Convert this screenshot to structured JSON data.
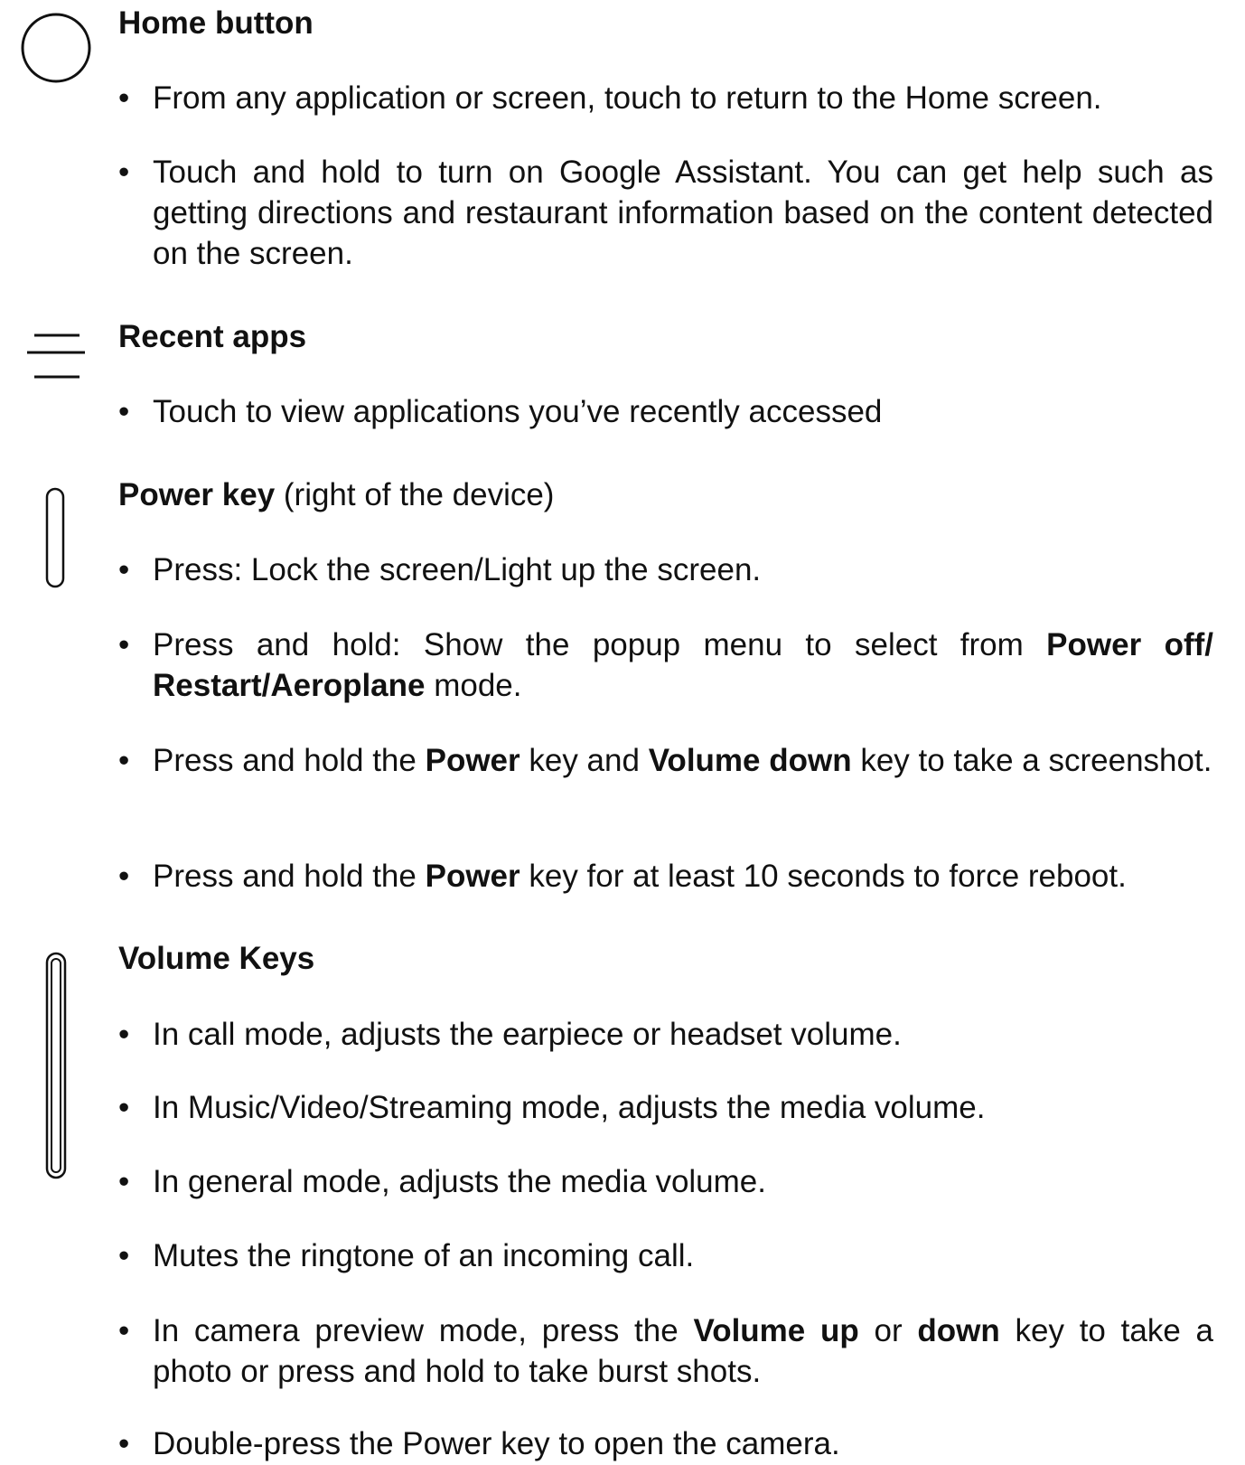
{
  "icons": {
    "home": "circle-outline-icon",
    "recent": "three-lines-icon",
    "power": "side-button-icon",
    "volume": "long-side-button-icon"
  },
  "home": {
    "title": "Home button",
    "b1": "From any application or screen, touch to return to the Home screen.",
    "b2": "Touch and hold to turn on Google Assistant. You can get help such as getting directions and restaurant information based on the content detected on the screen."
  },
  "recent": {
    "title": "Recent apps",
    "b1": "Touch to view applications you’ve recently accessed"
  },
  "power": {
    "title": "Power key",
    "title_suffix": " (right of the device)",
    "b1": "Press: Lock the screen/Light up the screen.",
    "b2_pre": "Press and hold: Show the popup menu to select from ",
    "b2_bold": "Power off/ Restart/Aeroplane",
    "b2_post": " mode.",
    "b3_pre": "Press and hold the ",
    "b3_bold1": "Power",
    "b3_mid": " key and ",
    "b3_bold2": "Volume down",
    "b3_post": " key to take a screenshot.",
    "b4_pre": "Press and hold the ",
    "b4_bold": "Power",
    "b4_post": " key for at least 10 seconds to force reboot."
  },
  "volume": {
    "title": "Volume Keys",
    "b1": "In call mode, adjusts the earpiece or headset volume.",
    "b2": "In Music/Video/Streaming mode, adjusts the media volume.",
    "b3": "In general mode, adjusts the media volume.",
    "b4": "Mutes the ringtone of an incoming call.",
    "b5_pre": "In camera preview mode, press the ",
    "b5_bold1": "Volume up",
    "b5_mid": " or ",
    "b5_bold2": "down",
    "b5_post": " key to take a photo or press and hold to take burst shots.",
    "b6": "Double-press the Power key to open the camera."
  },
  "bullet_char": "•"
}
